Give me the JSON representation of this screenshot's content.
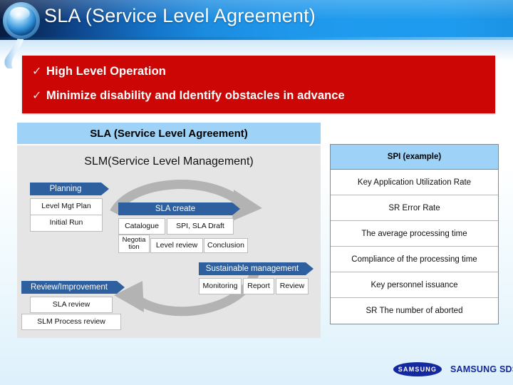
{
  "header": {
    "title": "SLA (Service Level Agreement)",
    "gradient_from": "#071c3f",
    "gradient_to": "#1f9bee"
  },
  "highlight_box": {
    "background": "#cc0505",
    "check_glyph": "✓",
    "bullets": [
      "High Level Operation",
      "Minimize disability and Identify obstacles in advance"
    ]
  },
  "slm_panel": {
    "banner": "SLA (Service Level Agreement)",
    "banner_color": "#9ed2f7",
    "title": "SLM(Service Level Management)",
    "body_color": "#e5e5e5",
    "arrow_color": "#2e5f9e",
    "cycle_arrow_color": "#b3b3b3",
    "stages": [
      {
        "heading": "Planning",
        "items": [
          "Level Mgt Plan",
          "Initial Run"
        ]
      },
      {
        "heading": "SLA  create",
        "items": [
          "Catalogue",
          "SPI,  SLA Draft",
          "Negotia tion",
          "Level review",
          "Conclusion"
        ]
      },
      {
        "heading": "Sustainable management",
        "items": [
          "Monitoring",
          "Report",
          "Review"
        ]
      },
      {
        "heading": "Review/Improvement",
        "items": [
          "SLA  review",
          "SLM Process review"
        ]
      }
    ],
    "negotiation_line1": "Negotia",
    "negotiation_line2": "tion"
  },
  "spi_panel": {
    "header": "SPI (example)",
    "header_color": "#9ed2f7",
    "rows": [
      "Key Application Utilization Rate",
      "SR Error Rate",
      "The average processing time",
      "Compliance of the processing time",
      "Key personnel issuance",
      "SR The number of aborted"
    ]
  },
  "footer": {
    "logo_mark": "SAMSUNG",
    "logo_text": "SAMSUNG SDS",
    "logo_color": "#1428a0"
  }
}
